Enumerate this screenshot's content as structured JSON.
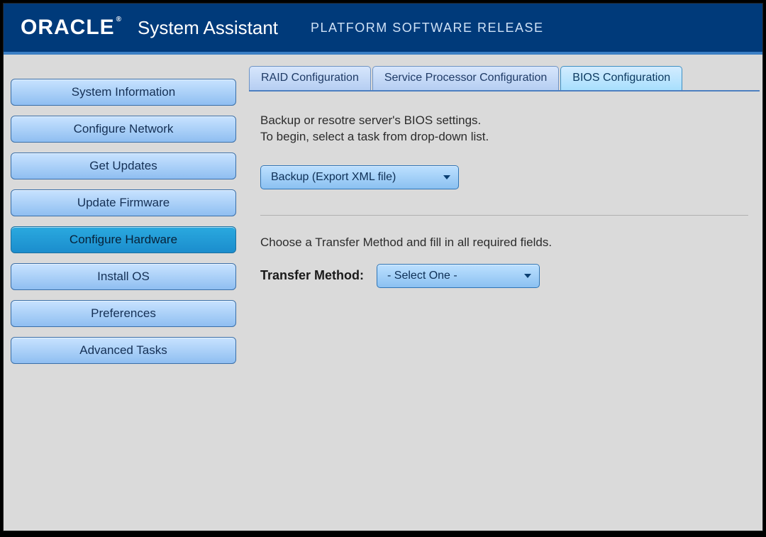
{
  "header": {
    "logo": "ORACLE",
    "logo_mark": "®",
    "title": "System Assistant",
    "subtitle": "PLATFORM SOFTWARE RELEASE"
  },
  "sidebar": {
    "items": [
      {
        "label": "System Information",
        "active": false
      },
      {
        "label": "Configure Network",
        "active": false
      },
      {
        "label": "Get Updates",
        "active": false
      },
      {
        "label": "Update Firmware",
        "active": false
      },
      {
        "label": "Configure Hardware",
        "active": true
      },
      {
        "label": "Install OS",
        "active": false
      },
      {
        "label": "Preferences",
        "active": false
      },
      {
        "label": "Advanced Tasks",
        "active": false
      }
    ]
  },
  "tabs": [
    {
      "label": "RAID Configuration",
      "active": false
    },
    {
      "label": "Service Processor Configuration",
      "active": false
    },
    {
      "label": "BIOS Configuration",
      "active": true
    }
  ],
  "panel": {
    "intro_line1": "Backup or resotre server's BIOS settings.",
    "intro_line2": "To begin, select a task from drop-down list.",
    "task_dropdown_value": "Backup (Export XML file)",
    "transfer_prompt": "Choose a Transfer Method and fill in all required fields.",
    "transfer_label": "Transfer Method:",
    "transfer_dropdown_value": "- Select One -"
  }
}
